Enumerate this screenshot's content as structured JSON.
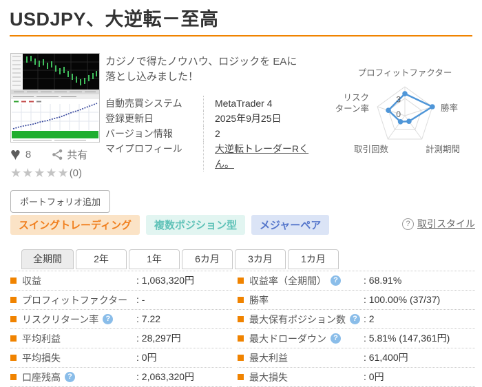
{
  "page": {
    "title": "USDJPY、大逆転－至高"
  },
  "colors": {
    "accent_orange": "#f08300",
    "radar_blue": "#4f96d8",
    "help_blue": "#8abde9"
  },
  "product": {
    "description_lines": [
      "カジノで得たノウハウ、ロジックを EAに",
      "落とし込みました！"
    ],
    "info_rows": [
      {
        "label": "自動売買システム",
        "value": "MetaTrader 4",
        "link": false
      },
      {
        "label": "登録更新日",
        "value": "2025年9月25日",
        "link": false
      },
      {
        "label": "バージョン情報",
        "value": "2",
        "link": false
      },
      {
        "label": "マイプロフィール",
        "value": "大逆転トレーダーRくん。",
        "link": true
      }
    ]
  },
  "social": {
    "heart_icon": "♥",
    "likes": "8",
    "share_label": "共有",
    "stars": "★★★★★",
    "rating_count": "(0)"
  },
  "portfolio_button_label": "ポートフォリオ追加",
  "tags": [
    {
      "label": "スイングトレーディング",
      "text_color": "#f07f1e",
      "bg_color": "#fbe3c6"
    },
    {
      "label": "複数ポジション型",
      "text_color": "#5fc2b8",
      "bg_color": "#e2f5f1"
    },
    {
      "label": "メジャーペア",
      "text_color": "#5576cb",
      "bg_color": "#dbe4f6"
    }
  ],
  "trade_style": {
    "help_glyph": "?",
    "label": "取引スタイル"
  },
  "tabs": [
    {
      "label": "全期間",
      "active": true
    },
    {
      "label": "2年",
      "active": false
    },
    {
      "label": "1年",
      "active": false
    },
    {
      "label": "6カ月",
      "active": false
    },
    {
      "label": "3カ月",
      "active": false
    },
    {
      "label": "1カ月",
      "active": false
    }
  ],
  "chart_data": {
    "type": "radar",
    "title": "",
    "axes": [
      "プロフィットファクター",
      "勝率",
      "計測期間",
      "取引回数",
      "リスク\nターン率"
    ],
    "values": [
      3.8,
      5,
      1.2,
      1.3,
      3
    ],
    "max": 5,
    "grid_rings": [
      5,
      3
    ],
    "tick_labels": [
      {
        "value": 3,
        "label": "3"
      },
      {
        "value": 0,
        "label": "0"
      }
    ],
    "line_color": "#4f96d8",
    "grid_color": "#dcdcdc"
  },
  "stats": {
    "left": [
      {
        "label": "収益",
        "help": false,
        "value": ": 1,063,320円"
      },
      {
        "label": "プロフィットファクター",
        "help": false,
        "value": ": -"
      },
      {
        "label": "リスクリターン率",
        "help": true,
        "value": ": 7.22"
      },
      {
        "label": "平均利益",
        "help": false,
        "value": ": 28,297円"
      },
      {
        "label": "平均損失",
        "help": false,
        "value": ": 0円"
      },
      {
        "label": "口座残高",
        "help": true,
        "value": ": 2,063,320円"
      }
    ],
    "right": [
      {
        "label": "収益率（全期間）",
        "help": true,
        "value": ": 68.91%"
      },
      {
        "label": "勝率",
        "help": false,
        "value": ": 100.00% (37/37)"
      },
      {
        "label": "最大保有ポジション数",
        "help": true,
        "value": ": 2"
      },
      {
        "label": "最大ドローダウン",
        "help": true,
        "value": ": 5.81% (147,361円)"
      },
      {
        "label": "最大利益",
        "help": false,
        "value": ": 61,400円"
      },
      {
        "label": "最大損失",
        "help": false,
        "value": ": 0円"
      }
    ]
  }
}
